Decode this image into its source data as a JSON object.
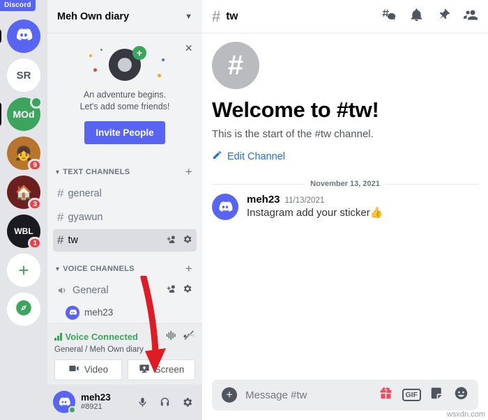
{
  "brand": {
    "name": "Discord"
  },
  "rail": {
    "items": [
      {
        "name": "discord-home",
        "label": "",
        "kind": "logo",
        "badge": ""
      },
      {
        "name": "server-sr",
        "label": "SR",
        "kind": "text",
        "badge": ""
      },
      {
        "name": "server-mod",
        "label": "MOd",
        "kind": "text",
        "badge": "",
        "status": "online"
      },
      {
        "name": "server-avatar-girl",
        "label": "",
        "kind": "image",
        "badge": "9"
      },
      {
        "name": "server-avatar-house",
        "label": "",
        "kind": "image",
        "badge": "3"
      },
      {
        "name": "server-wbl",
        "label": "WBL",
        "kind": "text",
        "badge": "1"
      },
      {
        "name": "add-server",
        "label": "+",
        "kind": "action",
        "badge": ""
      },
      {
        "name": "explore-servers",
        "label": "",
        "kind": "compass",
        "badge": ""
      }
    ]
  },
  "sidebar": {
    "guild_name": "Meh Own diary",
    "promo": {
      "line1": "An adventure begins.",
      "line2": "Let's add some friends!",
      "button": "Invite People",
      "close": "×"
    },
    "categories": [
      {
        "label": "TEXT CHANNELS",
        "add": "+",
        "channels": [
          {
            "name": "general",
            "active": false,
            "type": "text"
          },
          {
            "name": "gyawun",
            "active": false,
            "type": "text"
          },
          {
            "name": "tw",
            "active": true,
            "type": "text"
          }
        ]
      },
      {
        "label": "VOICE CHANNELS",
        "add": "+",
        "channels": [
          {
            "name": "General",
            "active": false,
            "type": "voice"
          }
        ],
        "voice_members": [
          {
            "name": "meh23"
          }
        ]
      }
    ],
    "voice_panel": {
      "status": "Voice Connected",
      "location": "General / Meh Own diary",
      "video_button": "Video",
      "screen_button": "Screen"
    },
    "user": {
      "name": "meh23",
      "tag": "#8921",
      "status": "online"
    }
  },
  "channel_header": {
    "hash": "#",
    "name": "tw"
  },
  "welcome": {
    "hash": "#",
    "title": "Welcome to #tw!",
    "subtitle": "This is the start of the #tw channel.",
    "edit_link": "Edit Channel"
  },
  "date_divider": "November 13, 2021",
  "messages": [
    {
      "author": "meh23",
      "timestamp": "11/13/2021",
      "text": "Instagram add your sticker👍"
    }
  ],
  "composer": {
    "placeholder": "Message #tw"
  },
  "watermark": "wsxdn.com",
  "colors": {
    "accent": "#5865f2",
    "online": "#3ba55d",
    "danger": "#ed4245",
    "link": "#1f6feb",
    "arrow": "#e01b24"
  }
}
